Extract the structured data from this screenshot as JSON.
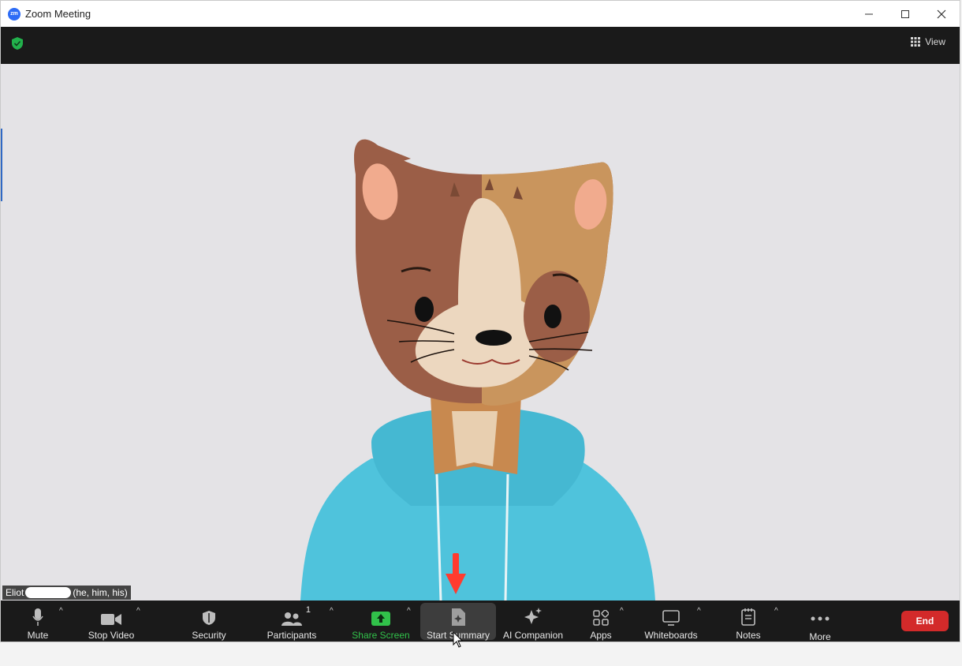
{
  "window": {
    "title": "Zoom Meeting",
    "logo_text": "zm",
    "controls": [
      "minimize-icon",
      "maximize-icon",
      "close-icon"
    ]
  },
  "topbar": {
    "view_label": "View"
  },
  "participant": {
    "name": "Eliot",
    "pronouns": "(he, him, his)"
  },
  "toolbar": {
    "mute": "Mute",
    "stop_video": "Stop Video",
    "security": "Security",
    "participants": "Participants",
    "participants_count": "1",
    "share_screen": "Share Screen",
    "start_summary": "Start Summary",
    "ai_companion": "AI Companion",
    "apps": "Apps",
    "whiteboards": "Whiteboards",
    "notes": "Notes",
    "more": "More",
    "end": "End"
  },
  "colors": {
    "toolbar_bg": "#1a1a1a",
    "share_green": "#31c14a",
    "end_red": "#d32a2a",
    "stage_bg": "#e4e3e6",
    "hoodie": "#4fc3dc"
  }
}
